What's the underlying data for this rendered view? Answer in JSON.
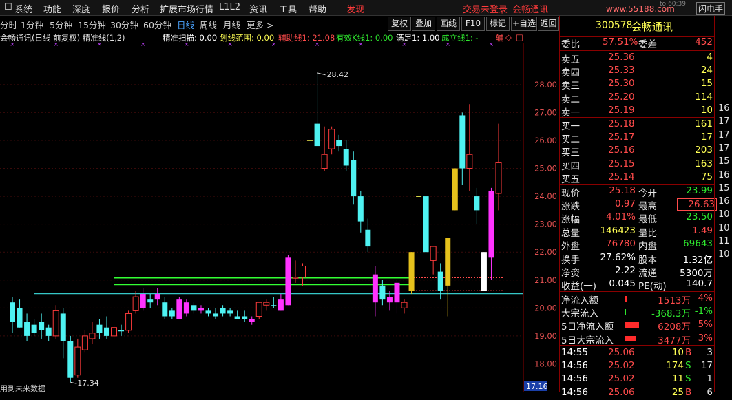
{
  "menu": {
    "items": [
      "系统",
      "功能",
      "深度",
      "报价",
      "分析",
      "扩展市场行情",
      "L1L2",
      "资讯",
      "工具",
      "帮助"
    ],
    "discover": "发现",
    "login_status": "交易未登录",
    "stock_name": "会畅通讯",
    "watermark": "www.55188.com",
    "time_fragment": "to:60:39",
    "flash_trade": "闪电手"
  },
  "timeframes": {
    "items": [
      "分时",
      "1分钟",
      "5分钟",
      "15分钟",
      "30分钟",
      "60分钟",
      "日线",
      "周线",
      "月线",
      "更多 >"
    ],
    "active": "日线"
  },
  "toolbar": {
    "buttons": [
      "复权",
      "叠加",
      "画线",
      "F10",
      "标记",
      "+自选",
      "返回"
    ]
  },
  "info": {
    "title": "会畅通讯(日线 前复权) 精准线(1,2)",
    "scan": "精准扫描: 0.00",
    "range": "划线范围: 0.00",
    "aux": "辅助线1: 21.08",
    "valid": "有效K线1: 0.00",
    "satisfy": "满足1: 1.00",
    "form": "成立线1: -",
    "tail": "辅"
  },
  "overlay": {
    "bottom_note": "用到未来数据",
    "price_box": "17.16"
  },
  "colors": {
    "up": "#ff3b3b",
    "down": "#4ef2f2",
    "gold": "#e6c21c",
    "magenta": "#ff33ff",
    "green_line": "#33ff33",
    "cyan_line": "#35c7c7"
  },
  "chart_data": {
    "type": "candlestick",
    "ylim": [
      17.0,
      29.5
    ],
    "yticks": [
      "28.00",
      "27.00",
      "26.00",
      "25.00",
      "24.00",
      "23.00",
      "22.00",
      "21.00",
      "20.00",
      "19.00",
      "18.00"
    ],
    "high_label": "28.42",
    "low_label": "17.34",
    "lines": [
      {
        "name": "辅助线1",
        "value": 21.08
      },
      {
        "name": "",
        "value": 20.84
      },
      {
        "name": "",
        "value": 20.52
      }
    ],
    "candles": [
      {
        "o": 20.2,
        "h": 20.4,
        "l": 19.1,
        "c": 19.5,
        "k": "down"
      },
      {
        "o": 20.0,
        "h": 20.3,
        "l": 19.3,
        "c": 19.3,
        "k": "down"
      },
      {
        "o": 19.5,
        "h": 19.8,
        "l": 18.8,
        "c": 19.0,
        "k": "down"
      },
      {
        "o": 19.4,
        "h": 19.6,
        "l": 19.0,
        "c": 19.1,
        "k": "down"
      },
      {
        "o": 19.5,
        "h": 19.8,
        "l": 18.9,
        "c": 19.2,
        "k": "down"
      },
      {
        "o": 19.3,
        "h": 19.4,
        "l": 18.8,
        "c": 19.0,
        "k": "down"
      },
      {
        "o": 19.0,
        "h": 20.1,
        "l": 18.9,
        "c": 19.9,
        "k": "up"
      },
      {
        "o": 19.8,
        "h": 20.0,
        "l": 18.2,
        "c": 18.8,
        "k": "down"
      },
      {
        "o": 18.8,
        "h": 19.0,
        "l": 17.34,
        "c": 17.5,
        "k": "down"
      },
      {
        "o": 17.6,
        "h": 18.9,
        "l": 17.5,
        "c": 18.6,
        "k": "up"
      },
      {
        "o": 18.5,
        "h": 19.2,
        "l": 18.4,
        "c": 19.0,
        "k": "up"
      },
      {
        "o": 19.1,
        "h": 19.5,
        "l": 18.7,
        "c": 18.9,
        "k": "up"
      },
      {
        "o": 19.4,
        "h": 19.6,
        "l": 18.9,
        "c": 19.1,
        "k": "down"
      },
      {
        "o": 19.3,
        "h": 19.7,
        "l": 18.9,
        "c": 19.0,
        "k": "down"
      },
      {
        "o": 19.0,
        "h": 19.4,
        "l": 18.9,
        "c": 19.3,
        "k": "up"
      },
      {
        "o": 19.2,
        "h": 19.4,
        "l": 19.0,
        "c": 19.2,
        "k": "down"
      },
      {
        "o": 19.2,
        "h": 19.9,
        "l": 19.1,
        "c": 19.8,
        "k": "up"
      },
      {
        "o": 19.9,
        "h": 20.6,
        "l": 19.8,
        "c": 20.4,
        "k": "up"
      },
      {
        "o": 20.0,
        "h": 20.7,
        "l": 19.9,
        "c": 20.5,
        "k": "mag"
      },
      {
        "o": 20.2,
        "h": 20.5,
        "l": 20.0,
        "c": 20.3,
        "k": "down"
      },
      {
        "o": 20.5,
        "h": 20.7,
        "l": 20.1,
        "c": 20.3,
        "k": "mag"
      },
      {
        "o": 20.2,
        "h": 20.4,
        "l": 19.6,
        "c": 19.7,
        "k": "down"
      },
      {
        "o": 19.7,
        "h": 20.0,
        "l": 19.6,
        "c": 19.9,
        "k": "down"
      },
      {
        "o": 19.6,
        "h": 20.4,
        "l": 19.6,
        "c": 20.3,
        "k": "mag"
      },
      {
        "o": 19.8,
        "h": 20.3,
        "l": 19.7,
        "c": 20.2,
        "k": "mag"
      },
      {
        "o": 20.1,
        "h": 20.2,
        "l": 19.8,
        "c": 19.9,
        "k": "down"
      },
      {
        "o": 19.9,
        "h": 20.1,
        "l": 19.8,
        "c": 20.0,
        "k": "mag"
      },
      {
        "o": 19.9,
        "h": 20.0,
        "l": 19.7,
        "c": 19.8,
        "k": "down"
      },
      {
        "o": 19.8,
        "h": 20.0,
        "l": 19.6,
        "c": 19.7,
        "k": "down"
      },
      {
        "o": 19.8,
        "h": 20.1,
        "l": 19.7,
        "c": 20.0,
        "k": "down"
      },
      {
        "o": 19.9,
        "h": 20.0,
        "l": 19.7,
        "c": 19.8,
        "k": "down"
      },
      {
        "o": 19.7,
        "h": 19.9,
        "l": 19.6,
        "c": 19.6,
        "k": "down"
      },
      {
        "o": 19.7,
        "h": 19.9,
        "l": 19.5,
        "c": 19.6,
        "k": "down"
      },
      {
        "o": 19.5,
        "h": 19.7,
        "l": 19.4,
        "c": 19.6,
        "k": "mag"
      },
      {
        "o": 19.7,
        "h": 20.2,
        "l": 19.6,
        "c": 20.2,
        "k": "up"
      },
      {
        "o": 20.1,
        "h": 20.3,
        "l": 19.9,
        "c": 20.2,
        "k": "up"
      },
      {
        "o": 20.1,
        "h": 20.4,
        "l": 20.0,
        "c": 20.1,
        "k": "down"
      },
      {
        "o": 19.9,
        "h": 20.5,
        "l": 19.9,
        "c": 20.3,
        "k": "mag"
      },
      {
        "o": 20.1,
        "h": 21.9,
        "l": 20.1,
        "c": 21.8,
        "k": "mag"
      },
      {
        "o": 21.1,
        "h": 21.7,
        "l": 20.9,
        "c": 21.1,
        "k": "up"
      },
      {
        "o": 21.1,
        "h": 21.6,
        "l": 20.8,
        "c": 21.5,
        "k": "up"
      },
      {
        "o": 26.0,
        "h": 26.0,
        "l": 26.0,
        "c": 26.0,
        "k": "doji"
      },
      {
        "o": 26.6,
        "h": 28.42,
        "l": 26.0,
        "c": 25.8,
        "k": "down"
      },
      {
        "o": 25.0,
        "h": 26.5,
        "l": 24.9,
        "c": 25.5,
        "k": "up"
      },
      {
        "o": 25.7,
        "h": 26.5,
        "l": 25.5,
        "c": 26.4,
        "k": "up"
      },
      {
        "o": 26.0,
        "h": 26.2,
        "l": 25.6,
        "c": 25.8,
        "k": "down"
      },
      {
        "o": 25.7,
        "h": 26.0,
        "l": 24.9,
        "c": 25.1,
        "k": "down"
      },
      {
        "o": 25.3,
        "h": 25.6,
        "l": 23.7,
        "c": 24.0,
        "k": "down"
      },
      {
        "o": 24.0,
        "h": 24.2,
        "l": 22.7,
        "c": 23.1,
        "k": "down"
      },
      {
        "o": 22.8,
        "h": 23.2,
        "l": 22.0,
        "c": 22.2,
        "k": "down"
      },
      {
        "o": 21.2,
        "h": 21.5,
        "l": 19.7,
        "c": 20.2,
        "k": "mag"
      },
      {
        "o": 20.8,
        "h": 21.0,
        "l": 20.1,
        "c": 20.3,
        "k": "down"
      },
      {
        "o": 20.4,
        "h": 20.6,
        "l": 19.9,
        "c": 20.2,
        "k": "mag"
      },
      {
        "o": 20.9,
        "h": 21.0,
        "l": 19.8,
        "c": 20.2,
        "k": "mag"
      },
      {
        "o": 20.0,
        "h": 20.3,
        "l": 19.8,
        "c": 20.2,
        "k": "up"
      },
      {
        "o": 20.6,
        "h": 22.0,
        "l": 20.5,
        "c": 22.0,
        "k": "gold"
      },
      {
        "o": 24.0,
        "h": 24.0,
        "l": 24.0,
        "c": 24.0,
        "k": "doji"
      },
      {
        "o": 24.0,
        "h": 24.0,
        "l": 22.0,
        "c": 22.0,
        "k": "down"
      },
      {
        "o": 22.2,
        "h": 22.2,
        "l": 21.2,
        "c": 21.7,
        "k": "up"
      },
      {
        "o": 21.3,
        "h": 21.6,
        "l": 20.3,
        "c": 20.6,
        "k": "down"
      },
      {
        "o": 20.8,
        "h": 22.5,
        "l": 19.7,
        "c": 22.5,
        "k": "gold"
      },
      {
        "o": 23.5,
        "h": 25.0,
        "l": 23.5,
        "c": 25.0,
        "k": "gold"
      },
      {
        "o": 25.0,
        "h": 27.0,
        "l": 24.4,
        "c": 26.9,
        "k": "down"
      },
      {
        "o": 25.0,
        "h": 27.3,
        "l": 24.2,
        "c": 25.5,
        "k": "up"
      },
      {
        "o": 24.0,
        "h": 24.3,
        "l": 23.0,
        "c": 23.5,
        "k": "down"
      },
      {
        "o": 20.6,
        "h": 22.0,
        "l": 20.6,
        "c": 22.0,
        "k": "white"
      },
      {
        "o": 21.8,
        "h": 24.3,
        "l": 21.0,
        "c": 24.2,
        "k": "mag"
      },
      {
        "o": 24.1,
        "h": 26.6,
        "l": 23.5,
        "c": 25.2,
        "k": "up"
      }
    ]
  },
  "quote": {
    "code": "300578",
    "name": "会畅通讯",
    "wb_label": "委比",
    "wb": "57.51%",
    "wc_label": "委差",
    "wc": "452",
    "asks": [
      {
        "label": "卖五",
        "price": "25.36",
        "vol": "4"
      },
      {
        "label": "卖四",
        "price": "25.33",
        "vol": "24"
      },
      {
        "label": "卖三",
        "price": "25.30",
        "vol": "15"
      },
      {
        "label": "卖二",
        "price": "25.20",
        "vol": "114"
      },
      {
        "label": "卖一",
        "price": "25.19",
        "vol": "10"
      }
    ],
    "bids": [
      {
        "label": "买一",
        "price": "25.18",
        "vol": "161"
      },
      {
        "label": "买二",
        "price": "25.17",
        "vol": "17"
      },
      {
        "label": "买三",
        "price": "25.16",
        "vol": "203"
      },
      {
        "label": "买四",
        "price": "25.15",
        "vol": "163"
      },
      {
        "label": "买五",
        "price": "25.14",
        "vol": "75"
      }
    ],
    "stats": [
      {
        "l1": "现价",
        "v1": "25.18",
        "c1": "r",
        "l2": "今开",
        "v2": "23.99",
        "c2": "g"
      },
      {
        "l1": "涨跌",
        "v1": "0.97",
        "c1": "r",
        "l2": "最高",
        "v2": "26.63",
        "c2": "r",
        "box": true
      },
      {
        "l1": "涨幅",
        "v1": "4.01%",
        "c1": "r",
        "l2": "最低",
        "v2": "23.50",
        "c2": "g"
      },
      {
        "l1": "总量",
        "v1": "146423",
        "c1": "y",
        "l2": "量比",
        "v2": "1.49",
        "c2": "r"
      },
      {
        "l1": "外盘",
        "v1": "76780",
        "c1": "r",
        "l2": "内盘",
        "v2": "69643",
        "c2": "g"
      }
    ],
    "stats2": [
      {
        "l1": "换手",
        "v1": "27.62%",
        "l2": "股本",
        "v2": "1.32亿"
      },
      {
        "l1": "净资",
        "v1": "2.22",
        "l2": "流通",
        "v2": "5300万"
      },
      {
        "l1": "收益(一)",
        "v1": "0.045",
        "l2": "PE(动)",
        "v2": "140.7"
      }
    ],
    "flows": [
      {
        "label": "净流入额",
        "value": "1513万",
        "pct": "4%",
        "bar": 0.12
      },
      {
        "label": "大宗流入",
        "value": "-368.3万",
        "pct": "-1%",
        "bar": 0.05
      },
      {
        "label": "5日净流入额",
        "value": "6208万",
        "pct": "5%",
        "bar": 0.7
      },
      {
        "label": "5日大宗流入",
        "value": "3477万",
        "pct": "3%",
        "bar": 0.55
      }
    ],
    "ticks": [
      {
        "time": "14:55",
        "price": "25.06",
        "vol": "10",
        "side": "B",
        "n": "3"
      },
      {
        "time": "14:56",
        "price": "25.02",
        "vol": "174",
        "side": "S",
        "n": "17"
      },
      {
        "time": "14:56",
        "price": "25.02",
        "vol": "11",
        "side": "S",
        "n": "1"
      },
      {
        "time": "14:56",
        "price": "25.06",
        "vol": "25",
        "side": "B",
        "n": "6"
      }
    ]
  },
  "edge_ticks": [
    "16",
    "17",
    "17",
    "17",
    "15",
    "16",
    "15",
    "16",
    "10",
    "10",
    "11",
    "10"
  ]
}
